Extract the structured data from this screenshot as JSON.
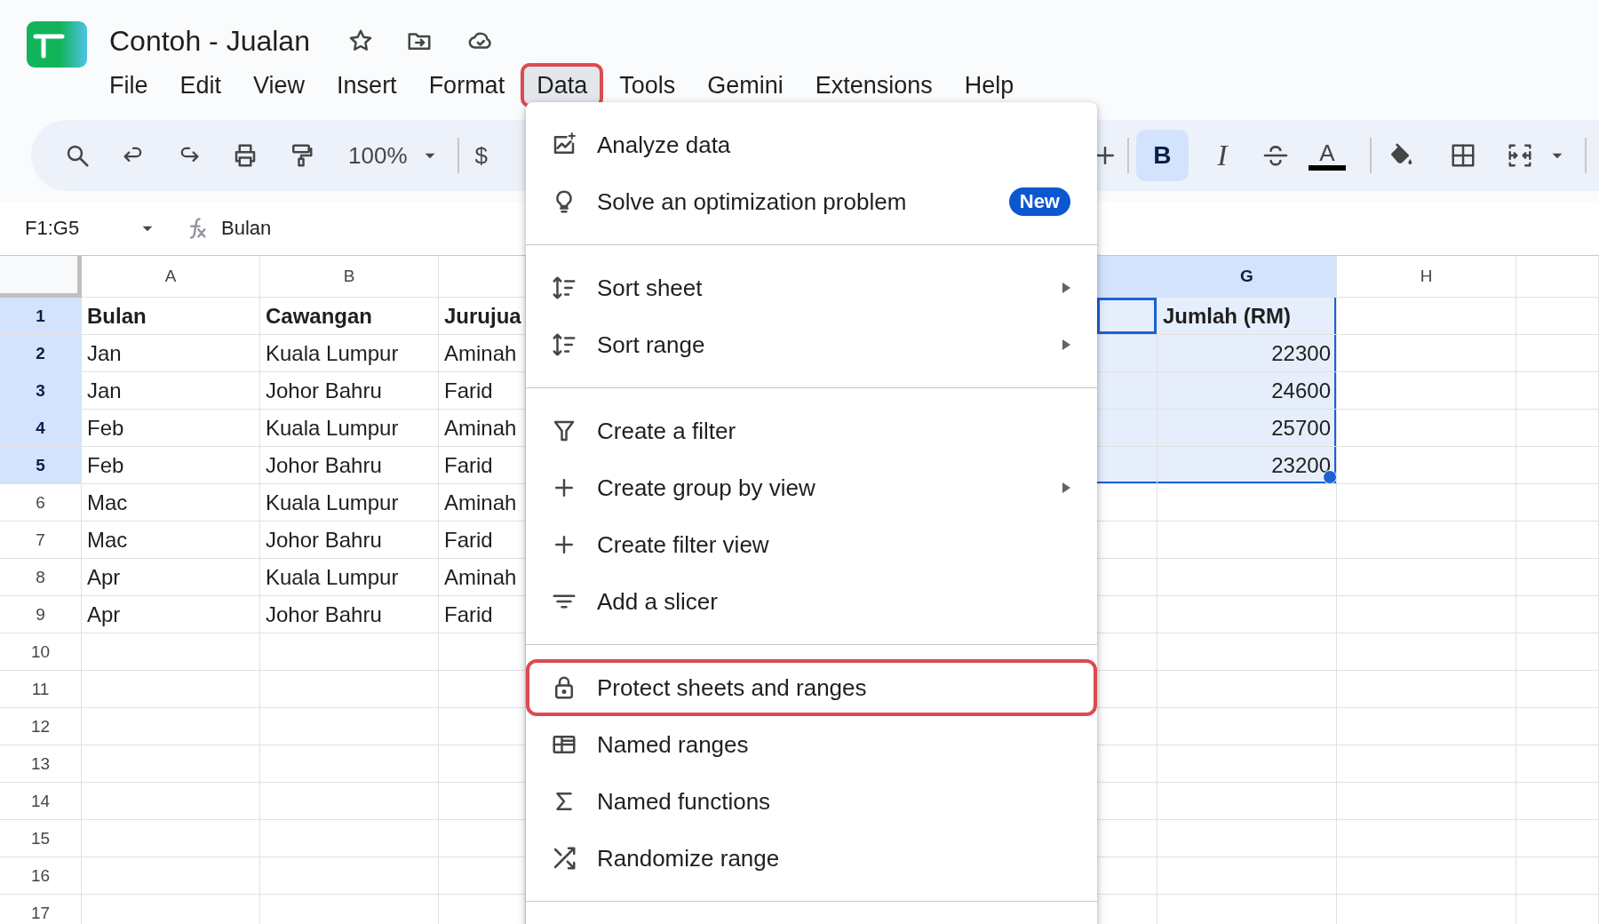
{
  "document": {
    "title": "Contoh - Jualan"
  },
  "menu_bar": [
    {
      "label": "File",
      "selected": false,
      "highlighted": false
    },
    {
      "label": "Edit",
      "selected": false,
      "highlighted": false
    },
    {
      "label": "View",
      "selected": false,
      "highlighted": false
    },
    {
      "label": "Insert",
      "selected": false,
      "highlighted": false
    },
    {
      "label": "Format",
      "selected": false,
      "highlighted": false
    },
    {
      "label": "Data",
      "selected": true,
      "highlighted": true
    },
    {
      "label": "Tools",
      "selected": false,
      "highlighted": false
    },
    {
      "label": "Gemini",
      "selected": false,
      "highlighted": false
    },
    {
      "label": "Extensions",
      "selected": false,
      "highlighted": false
    },
    {
      "label": "Help",
      "selected": false,
      "highlighted": false
    }
  ],
  "toolbar": {
    "zoom": "100%",
    "currency": "$",
    "bold": {
      "label": "B",
      "selected": true
    },
    "italic": "I",
    "text_color": "A"
  },
  "formula_bar": {
    "range": "F1:G5",
    "formula": "Bulan"
  },
  "columns": [
    {
      "label": "A",
      "selected": false
    },
    {
      "label": "B",
      "selected": false
    },
    {
      "selected": false
    },
    {
      "selected": true
    },
    {
      "label": "G",
      "selected": true
    },
    {
      "label": "H",
      "selected": false
    }
  ],
  "rows": [
    {
      "number": "1",
      "selected": true,
      "kind": "header",
      "cells": [
        {
          "text": "Bulan"
        },
        {
          "text": "Cawangan"
        },
        {
          "text": "Jurujua"
        },
        {
          "active": true
        },
        {
          "text": "Jumlah (RM)"
        },
        null
      ]
    },
    {
      "number": "2",
      "selected": true,
      "kind": "data",
      "cells": [
        {
          "text": "Jan"
        },
        {
          "text": "Kuala Lumpur"
        },
        {
          "text": "Aminah"
        },
        null,
        {
          "text": "22300",
          "kind": "number"
        },
        null
      ]
    },
    {
      "number": "3",
      "selected": true,
      "kind": "data",
      "cells": [
        {
          "text": "Jan"
        },
        {
          "text": "Johor Bahru"
        },
        {
          "text": "Farid"
        },
        null,
        {
          "text": "24600",
          "kind": "number"
        },
        null
      ]
    },
    {
      "number": "4",
      "selected": true,
      "kind": "data",
      "cells": [
        {
          "text": "Feb"
        },
        {
          "text": "Kuala Lumpur"
        },
        {
          "text": "Aminah"
        },
        null,
        {
          "text": "25700",
          "kind": "number"
        },
        null
      ]
    },
    {
      "number": "5",
      "selected": true,
      "kind": "data",
      "cells": [
        {
          "text": "Feb"
        },
        {
          "text": "Johor Bahru"
        },
        {
          "text": "Farid"
        },
        null,
        {
          "text": "23200",
          "kind": "number"
        },
        null
      ]
    },
    {
      "number": "6",
      "selected": false,
      "kind": "data",
      "cells": [
        {
          "text": "Mac"
        },
        {
          "text": "Kuala Lumpur"
        },
        {
          "text": "Aminah"
        }
      ]
    },
    {
      "number": "7",
      "selected": false,
      "kind": "data",
      "cells": [
        {
          "text": "Mac"
        },
        {
          "text": "Johor Bahru"
        },
        {
          "text": "Farid"
        }
      ]
    },
    {
      "number": "8",
      "selected": false,
      "kind": "data",
      "cells": [
        {
          "text": "Apr"
        },
        {
          "text": "Kuala Lumpur"
        },
        {
          "text": "Aminah"
        }
      ]
    },
    {
      "number": "9",
      "selected": false,
      "kind": "data",
      "cells": [
        {
          "text": "Apr"
        },
        {
          "text": "Johor Bahru"
        },
        {
          "text": "Farid"
        }
      ]
    },
    {
      "number": "10",
      "selected": false,
      "kind": "data"
    },
    {
      "number": "11",
      "selected": false,
      "kind": "data"
    },
    {
      "number": "12",
      "selected": false,
      "kind": "data"
    },
    {
      "number": "13",
      "selected": false,
      "kind": "data"
    },
    {
      "number": "14",
      "selected": false,
      "kind": "data"
    },
    {
      "number": "15",
      "selected": false,
      "kind": "data"
    },
    {
      "number": "16",
      "selected": false,
      "kind": "data"
    },
    {
      "number": "17",
      "selected": false,
      "kind": "data"
    }
  ],
  "data_menu": {
    "sections": [
      {
        "items": [
          {
            "label": "Analyze data",
            "submenu": false,
            "highlighted": false
          },
          {
            "label": "Solve an optimization problem",
            "badge": "New",
            "submenu": false,
            "highlighted": false
          }
        ]
      },
      {
        "items": [
          {
            "label": "Sort sheet",
            "submenu": true,
            "highlighted": false
          },
          {
            "label": "Sort range",
            "submenu": true,
            "highlighted": false
          }
        ]
      },
      {
        "items": [
          {
            "label": "Create a filter",
            "submenu": false,
            "highlighted": false
          },
          {
            "label": "Create group by view",
            "submenu": true,
            "highlighted": false
          },
          {
            "label": "Create filter view",
            "submenu": false,
            "highlighted": false
          },
          {
            "label": "Add a slicer",
            "submenu": false,
            "highlighted": false
          }
        ]
      },
      {
        "items": [
          {
            "label": "Protect sheets and ranges",
            "submenu": false,
            "highlighted": true
          },
          {
            "label": "Named ranges",
            "submenu": false,
            "highlighted": false
          },
          {
            "label": "Named functions",
            "submenu": false,
            "highlighted": false
          },
          {
            "label": "Randomize range",
            "submenu": false,
            "highlighted": false
          }
        ]
      }
    ]
  }
}
